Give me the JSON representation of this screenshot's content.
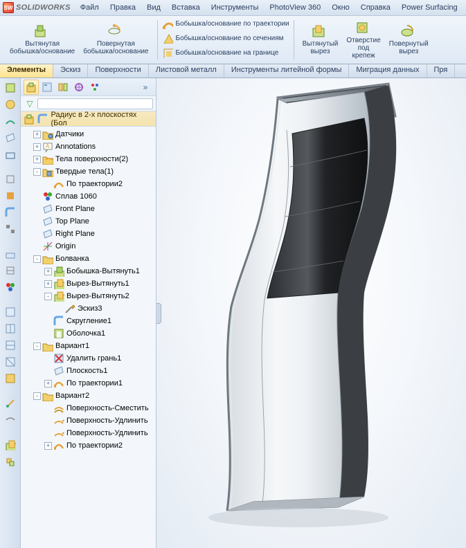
{
  "app_name": "SOLIDWORKS",
  "menus": [
    "Файл",
    "Правка",
    "Вид",
    "Вставка",
    "Инструменты",
    "PhotoView 360",
    "Окно",
    "Справка",
    "Power Surfacing"
  ],
  "ribbon": {
    "big_buttons": [
      {
        "label": "Вытянутая\nбобышка/основание",
        "kind": "extrude"
      },
      {
        "label": "Повернутая\nбобышка/основание",
        "kind": "revolve"
      }
    ],
    "text_items": [
      {
        "label": "Бобышка/основание по траектории",
        "kind": "sweep"
      },
      {
        "label": "Бобышка/основание по сечениям",
        "kind": "loft"
      },
      {
        "label": "Бобышка/основание на границе",
        "kind": "boundary"
      }
    ],
    "right_buttons": [
      {
        "label": "Вытянутый\nвырез",
        "kind": "extcut"
      },
      {
        "label": "Отверстие\nпод\nкрепеж",
        "kind": "hole"
      },
      {
        "label": "Повернутый\nвырез",
        "kind": "revcut"
      }
    ]
  },
  "panel_tabs": [
    "Элементы",
    "Эскиз",
    "Поверхности",
    "Листовой металл",
    "Инструменты литейной формы",
    "Миграция данных",
    "Пря"
  ],
  "panel_tabs_active": 0,
  "tree_title": "Радиус в 2-х плоскостях  (Бол",
  "tree": [
    {
      "d": 1,
      "t": "+",
      "icon": "folder-sensor",
      "label": "Датчики"
    },
    {
      "d": 1,
      "t": "+",
      "icon": "annot",
      "label": "Annotations"
    },
    {
      "d": 1,
      "t": "+",
      "icon": "surfbody",
      "label": "Тела поверхности(2)"
    },
    {
      "d": 1,
      "t": "-",
      "icon": "solidbody",
      "label": "Твердые тела(1)"
    },
    {
      "d": 2,
      "t": " ",
      "icon": "sweep-y",
      "label": "По траектории2"
    },
    {
      "d": 1,
      "t": " ",
      "icon": "material",
      "label": "Сплав 1060"
    },
    {
      "d": 1,
      "t": " ",
      "icon": "plane",
      "label": "Front Plane"
    },
    {
      "d": 1,
      "t": " ",
      "icon": "plane",
      "label": "Top Plane"
    },
    {
      "d": 1,
      "t": " ",
      "icon": "plane",
      "label": "Right Plane"
    },
    {
      "d": 1,
      "t": " ",
      "icon": "origin",
      "label": "Origin"
    },
    {
      "d": 1,
      "t": "-",
      "icon": "folder",
      "label": "Болванка"
    },
    {
      "d": 2,
      "t": "+",
      "icon": "extrude",
      "label": "Бобышка-Вытянуть1"
    },
    {
      "d": 2,
      "t": "+",
      "icon": "extcut",
      "label": "Вырез-Вытянуть1"
    },
    {
      "d": 2,
      "t": "-",
      "icon": "extcut",
      "label": "Вырез-Вытянуть2"
    },
    {
      "d": 3,
      "t": " ",
      "icon": "sketch",
      "label": "Эскиз3"
    },
    {
      "d": 2,
      "t": " ",
      "icon": "fillet",
      "label": "Скругление1"
    },
    {
      "d": 2,
      "t": " ",
      "icon": "shell",
      "label": "Оболочка1"
    },
    {
      "d": 1,
      "t": "-",
      "icon": "folder",
      "label": "Вариант1"
    },
    {
      "d": 2,
      "t": " ",
      "icon": "delface",
      "label": "Удалить грань1"
    },
    {
      "d": 2,
      "t": " ",
      "icon": "plane",
      "label": "Плоскость1"
    },
    {
      "d": 2,
      "t": "+",
      "icon": "sweep-y",
      "label": "По траектории1"
    },
    {
      "d": 1,
      "t": "-",
      "icon": "folder",
      "label": "Вариант2"
    },
    {
      "d": 2,
      "t": " ",
      "icon": "surf-offset",
      "label": "Поверхность-Сместить"
    },
    {
      "d": 2,
      "t": " ",
      "icon": "surf-ext",
      "label": "Поверхность-Удлинить"
    },
    {
      "d": 2,
      "t": " ",
      "icon": "surf-ext",
      "label": "Поверхность-Удлинить"
    },
    {
      "d": 2,
      "t": "+",
      "icon": "sweep-y",
      "label": "По траектории2"
    }
  ]
}
